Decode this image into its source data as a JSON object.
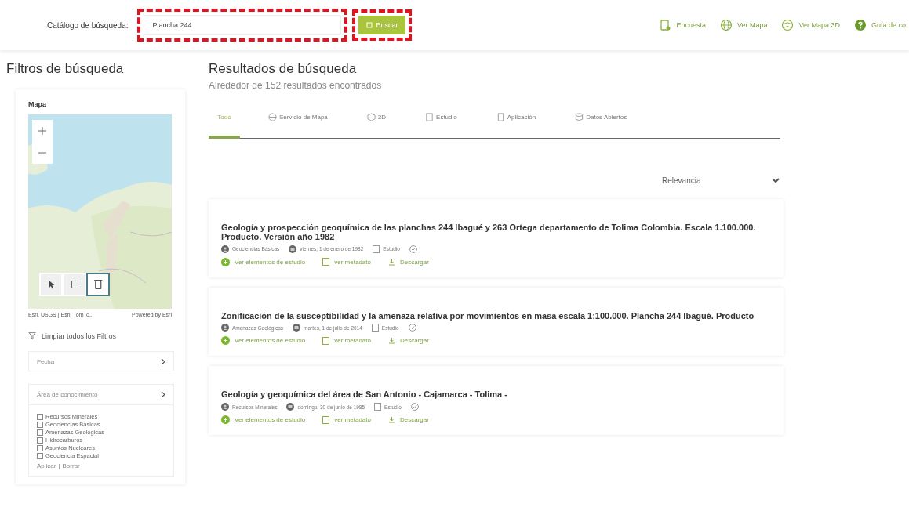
{
  "header": {
    "search_label": "Catálogo de búsqueda:",
    "search_value": "Plancha 244",
    "search_button": "Buscar",
    "links": [
      {
        "kind": "survey",
        "label": "Encuesta"
      },
      {
        "kind": "globe",
        "label": "Ver Mapa"
      },
      {
        "kind": "globe3d",
        "label": "Ver Mapa 3D"
      },
      {
        "kind": "help",
        "label": "Guía de co"
      }
    ]
  },
  "sidebar": {
    "title": "Filtros de búsqueda",
    "map_label": "Mapa",
    "map_attribution": "Esri, USGS | Esri, TomTo...",
    "map_powered": "Powered by Esri",
    "map_tools": [
      {
        "kind": "pointer",
        "selected": false
      },
      {
        "kind": "rectangle",
        "selected": false
      },
      {
        "kind": "trash",
        "selected": true
      }
    ],
    "clear_filters": "Limpiar todos los Filtros",
    "date_filter": "Fecha",
    "area_filter": "Área de conocimiento",
    "areas": [
      {
        "label": "Recursos Minerales",
        "checked": false
      },
      {
        "label": "Geociencias Básicas",
        "checked": false
      },
      {
        "label": "Amenazas Geológicas",
        "checked": false
      },
      {
        "label": "Hidrocarburos",
        "checked": false
      },
      {
        "label": "Asuntos Nucleares",
        "checked": false
      },
      {
        "label": "Geociencia Espacial",
        "checked": false
      }
    ],
    "apply": "Aplicar",
    "separator": "|",
    "clear": "Borrar"
  },
  "results": {
    "title": "Resultados de búsqueda",
    "count": "Alrededor de 152 resultados encontrados",
    "tabs": [
      {
        "kind": "all",
        "label": "Todo",
        "selected": true
      },
      {
        "kind": "map",
        "label": "Servicio de Mapa",
        "selected": false
      },
      {
        "kind": "cube",
        "label": "3D",
        "selected": false
      },
      {
        "kind": "study",
        "label": "Estudio",
        "selected": false
      },
      {
        "kind": "app",
        "label": "Aplicación",
        "selected": false
      },
      {
        "kind": "data",
        "label": "Datos Abiertos",
        "selected": false
      }
    ],
    "sort": "Relevancia",
    "items": [
      {
        "title": "Geología y prospección geoquímica de las planchas 244 Ibagué y 263 Ortega departamento de Tolima Colombia. Escala 1.100.000. Producto. Versión año 1982",
        "category": "Geociencias Básicas",
        "date": "viernes, 1 de enero de 1982",
        "type": "Estudio",
        "view": "Ver elementos de estudio",
        "metadata": "ver metadato",
        "download": "Descargar"
      },
      {
        "title": "Zonificación de la susceptibilidad y la amenaza relativa por movimientos en masa escala 1:100.000. Plancha 244 Ibagué. Producto",
        "category": "Amenazas Geológicas",
        "date": "martes, 1 de julio de 2014",
        "type": "Estudio",
        "view": "Ver elementos de estudio",
        "metadata": "ver metadato",
        "download": "Descargar"
      },
      {
        "title": "Geología y geoquímica del área de San Antonio - Cajamarca - Tolima -",
        "category": "Recursos Minerales",
        "date": "domingo, 30 de junio de 1985",
        "type": "Estudio",
        "view": "Ver elementos de estudio",
        "metadata": "ver metadato",
        "download": "Descargar"
      }
    ]
  }
}
